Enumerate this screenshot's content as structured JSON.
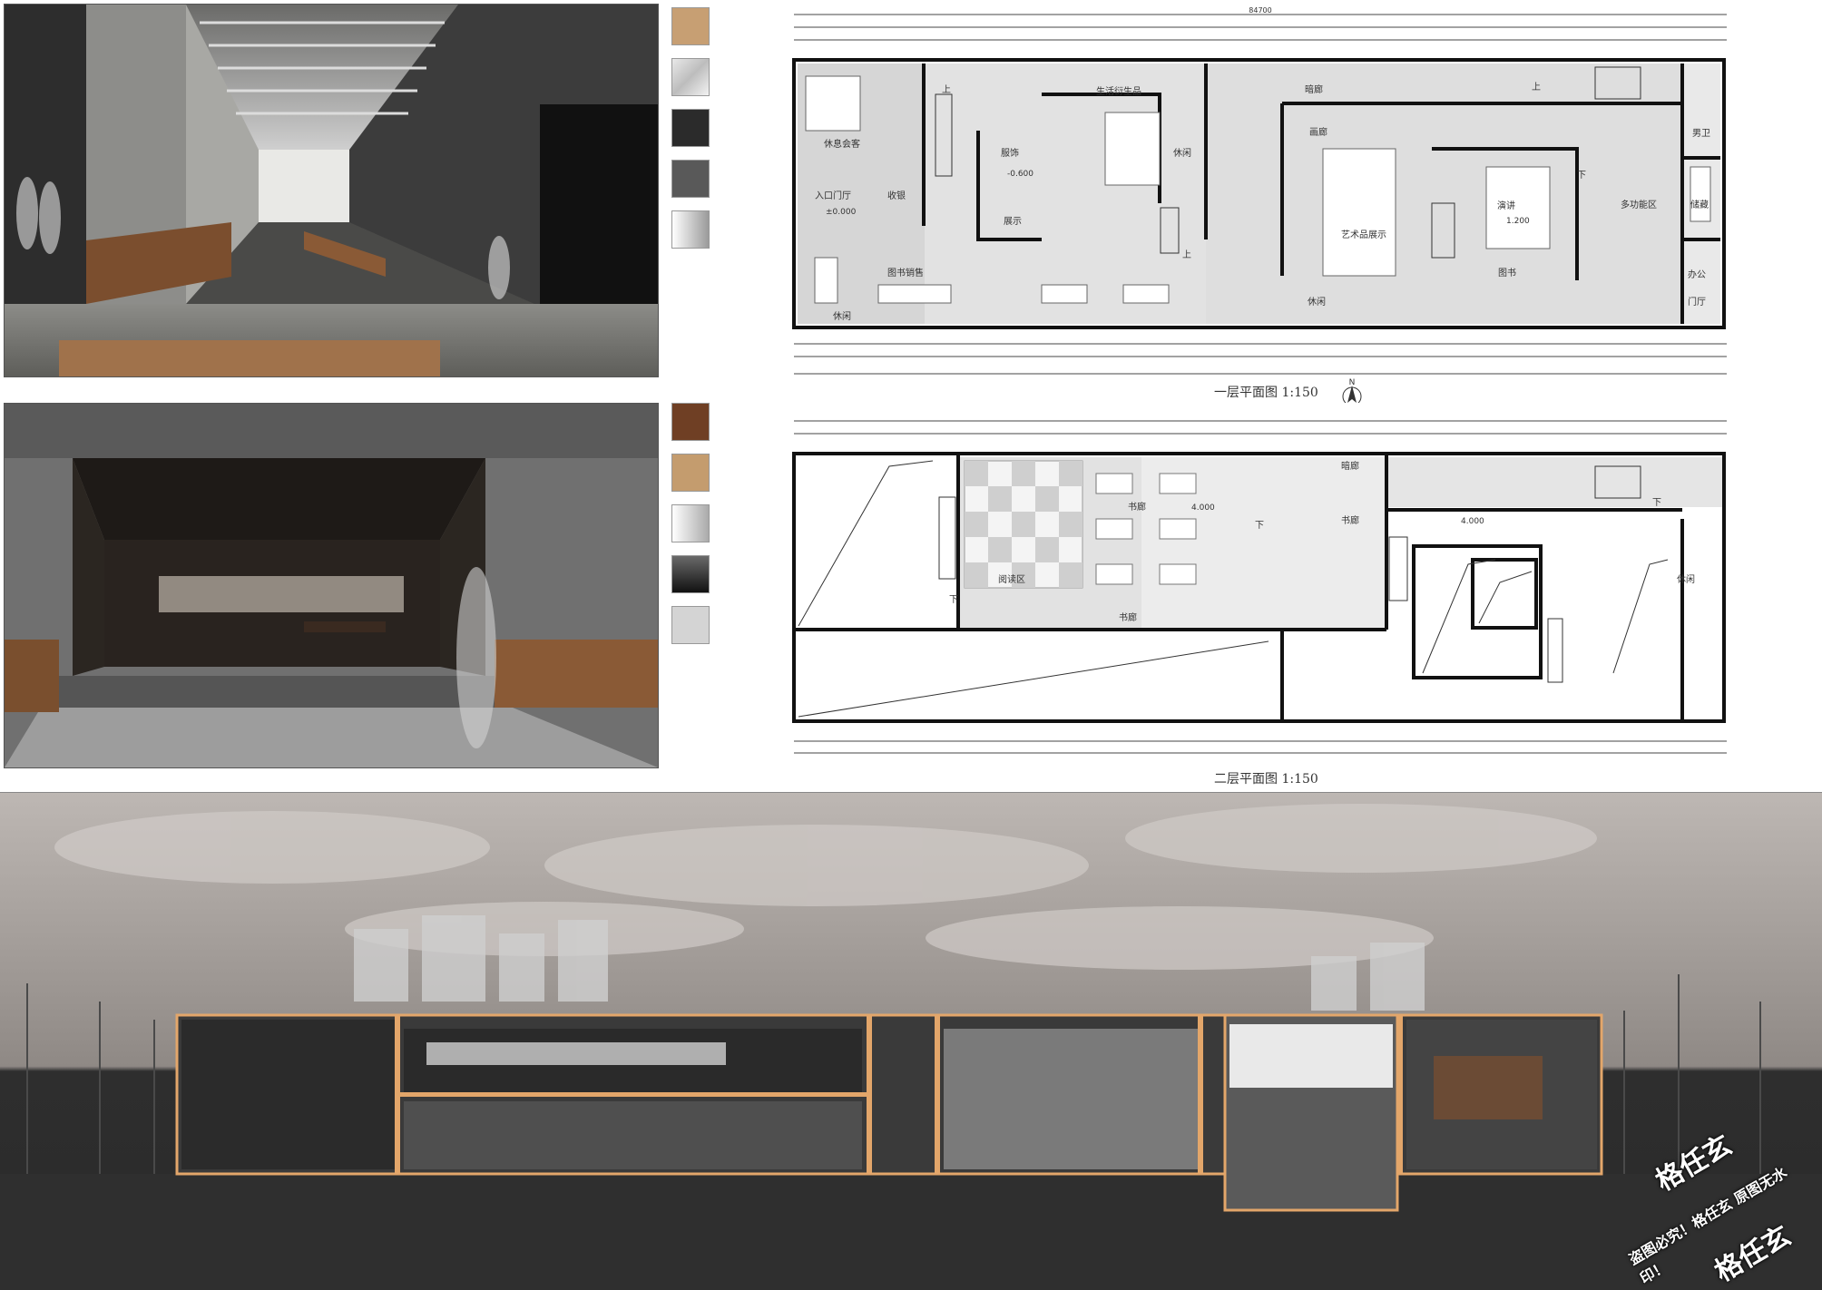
{
  "plan_1f": {
    "caption": "一层平面图 1:150",
    "overall_dim": "84700",
    "labels": {
      "lounge": "休息会客",
      "lobby": "入口门厅",
      "cashier": "收银",
      "entry_level": "±0.000",
      "apparel": "服饰",
      "apparel_level": "-0.600",
      "display": "展示",
      "goods": "生活衍生品",
      "leisure_a": "休闲",
      "book_sales": "图书销售",
      "leisure_b": "休闲",
      "dark_corridor": "暗廊",
      "gallery": "画廊",
      "art_display": "艺术品展示",
      "leisure_c": "休闲",
      "lecture": "演讲",
      "lecture_level": "1.200",
      "books": "图书",
      "multi": "多功能区",
      "storage": "储藏",
      "office": "办公",
      "toilet": "男卫",
      "entrance": "门厅",
      "up_a": "上",
      "up_b": "上",
      "up_c": "上",
      "down_a": "下"
    },
    "north": "N"
  },
  "plan_2f": {
    "caption": "二层平面图 1:150",
    "labels": {
      "dark_corridor": "暗廊",
      "books_a": "书廊",
      "level_a": "4.000",
      "reading": "阅读区",
      "books_b": "书廊",
      "books_c": "书廊",
      "level_b": "4.000",
      "leisure": "休闲",
      "down_a": "下",
      "down_b": "下",
      "down_c": "下"
    }
  },
  "watermark": {
    "brand_a": "格任玄",
    "notice": "盗图必究！格任玄 原图无水印！",
    "brand_b": "格任玄"
  },
  "colors": {
    "wood": "#8a5a36",
    "concrete": "#6e6e6e",
    "wall_section": "#d7a06b"
  }
}
